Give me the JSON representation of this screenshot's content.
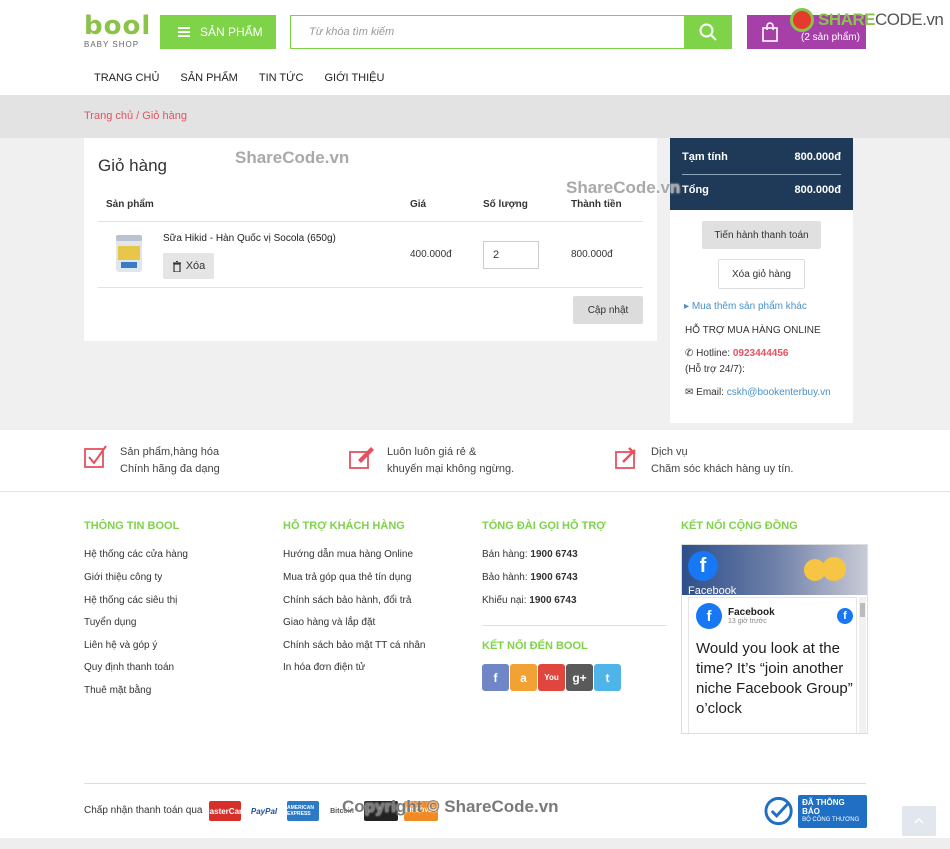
{
  "header": {
    "logo_word": "bool",
    "logo_sub": "BABY SHOP",
    "menu_button": "SẢN PHẨM",
    "search_placeholder": "Từ khóa tìm kiếm",
    "cart_count": "(2 sản phẩm)",
    "watermark_logo_a": "SHARE",
    "watermark_logo_b": "CODE.vn"
  },
  "nav": [
    "TRANG CHỦ",
    "SẢN PHẨM",
    "TIN TỨC",
    "GIỚI THIỆU"
  ],
  "breadcrumb": "Trang chủ / Giỏ hàng",
  "cart": {
    "title": "Giỏ hàng",
    "columns": [
      "Sản phẩm",
      "Giá",
      "Số lượng",
      "Thành tiền"
    ],
    "item": {
      "name": "Sữa Hikid - Hàn Quốc vị Socola (650g)",
      "delete": "Xóa",
      "price": "400.000đ",
      "qty": "2",
      "total": "800.000đ"
    },
    "update": "Cập nhật"
  },
  "summary": {
    "subtotal_label": "Tạm tính",
    "subtotal": "800.000đ",
    "total_label": "Tổng",
    "total": "800.000đ",
    "checkout": "Tiến hành thanh toán",
    "clear": "Xóa giỏ hàng",
    "more": "Mua thêm sản phẩm khác",
    "support": "HỖ TRỢ MUA HÀNG ONLINE",
    "hotline_label": "Hotline:",
    "hotline": "0923444456",
    "h247": "(Hỗ trợ 24/7):",
    "email_label": "Email:",
    "email": "cskh@bookenterbuy.vn"
  },
  "features": [
    {
      "l1": "Sản phẩm,hàng hóa",
      "l2": "Chính hãng đa dạng"
    },
    {
      "l1": "Luôn luôn giá rẻ &",
      "l2": "khuyến mại không ngừng."
    },
    {
      "l1": "Dịch vụ",
      "l2": "Chăm sóc khách hàng uy tín."
    }
  ],
  "footer": {
    "col1_title": "THÔNG TIN BOOL",
    "col1": [
      "Hệ thống các cửa hàng",
      "Giới thiệu công ty",
      "Hệ thống các siêu thị",
      "Tuyển dụng",
      "Liên hệ và góp ý",
      "Quy định thanh toán",
      "Thuê mặt bằng"
    ],
    "col2_title": "HỖ TRỢ KHÁCH HÀNG",
    "col2": [
      "Hướng dẫn mua hàng Online",
      "Mua trả góp qua thẻ tín dụng",
      "Chính sách bảo hành, đổi trả",
      "Giao hàng và lắp đặt",
      "Chính sách bảo mật TT cá nhân",
      "In hóa đơn điện tử"
    ],
    "col3_title": "TỔNG ĐÀI GỌI HỖ TRỢ",
    "col3": [
      {
        "label": "Bán hàng:",
        "num": "1900 6743"
      },
      {
        "label": "Bảo hành:",
        "num": "1900 6743"
      },
      {
        "label": "Khiếu nại:",
        "num": "1900 6743"
      }
    ],
    "social_title": "KẾT NỐI ĐẾN BOOL",
    "social": [
      "f",
      "a",
      "You",
      "g+",
      "t"
    ],
    "col4_title": "KẾT NỐI CỘNG ĐỒNG",
    "fb_name": "Facebook",
    "fb_time": "13 giờ trước",
    "fb_header": "Facebook",
    "fb_text": "Would you look at the time? It’s “join another niche Facebook Group” o’clock",
    "pay_label": "Chấp nhận thanh toán qua",
    "cards": [
      "MasterCard",
      "PayPal",
      "AMERICAN EXPRESS",
      "Bitcoin",
      "",
      "DISCOVER"
    ],
    "copyright": "Copyright © ShareCode.vn",
    "badge_l1": "ĐÃ THÔNG BÁO",
    "badge_l2": "BỘ CÔNG THƯƠNG"
  },
  "watermarks": [
    "ShareCode.vn",
    "ShareCode.vn"
  ],
  "colors": {
    "green": "#7ed348",
    "purple": "#a640a8",
    "navy": "#1f3a58",
    "red": "#e5525f",
    "link": "#4a90c8"
  }
}
